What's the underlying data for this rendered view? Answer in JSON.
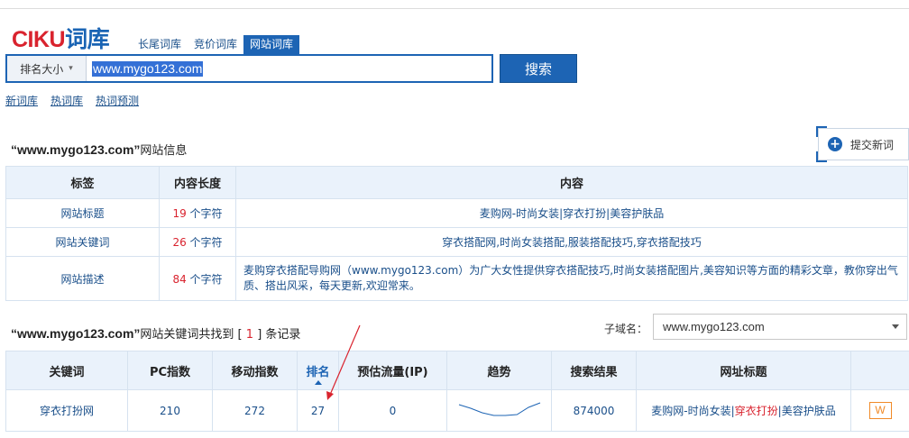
{
  "brand": {
    "logo_part1": "CIKU",
    "logo_part2": "词库"
  },
  "tabs": [
    {
      "label": "长尾词库",
      "active": false
    },
    {
      "label": "竞价词库",
      "active": false
    },
    {
      "label": "网站词库",
      "active": true
    }
  ],
  "search": {
    "select_label": "排名大小",
    "query": "www.mygo123.com",
    "button_label": "搜索"
  },
  "sublinks": [
    "新词库",
    "热词库",
    "热词预测"
  ],
  "site_info": {
    "title_domain": "“www.mygo123.com”",
    "title_suffix": "网站信息",
    "submit_label": "提交新词",
    "headers": [
      "标签",
      "内容长度",
      "内容"
    ],
    "rows": [
      {
        "label": "网站标题",
        "length": "19",
        "unit": "个字符",
        "content": "麦购网-时尚女装|穿衣打扮|美容护肤品"
      },
      {
        "label": "网站关键词",
        "length": "26",
        "unit": "个字符",
        "content": "穿衣搭配网,时尚女装搭配,服装搭配技巧,穿衣搭配技巧"
      },
      {
        "label": "网站描述",
        "length": "84",
        "unit": "个字符",
        "content": "麦购穿衣搭配导购网（www.mygo123.com）为广大女性提供穿衣搭配技巧,时尚女装搭配图片,美容知识等方面的精彩文章，教你穿出气质、搭出风采，每天更新,欢迎常来。"
      }
    ]
  },
  "keywords": {
    "title_domain": "“www.mygo123.com”",
    "title_mid": "网站关键词共找到 [",
    "count": "1",
    "title_end": "] 条记录",
    "subdomain_label": "子域名：",
    "subdomain_value": "www.mygo123.com",
    "headers": [
      "关键词",
      "PC指数",
      "移动指数",
      "排名",
      "预估流量(IP)",
      "趋势",
      "搜索结果",
      "网址标题",
      ""
    ],
    "rows": [
      {
        "keyword": "穿衣打扮网",
        "pc_index": "210",
        "mobile_index": "272",
        "rank": "27",
        "traffic": "0",
        "trend": [
          0.75,
          0.55,
          0.3,
          0.15,
          0.15,
          0.2,
          0.6,
          0.85
        ],
        "results": "874000",
        "url_title_a": "麦购网-时尚女装|",
        "url_title_b": "穿衣打扮",
        "url_title_c": "|美容护肤品",
        "action_icon": "W"
      }
    ]
  },
  "colors": {
    "brand_blue": "#1d64b4",
    "brand_red": "#d9232e",
    "link_blue": "#1a4f8a",
    "header_bg": "#eaf2fb"
  }
}
